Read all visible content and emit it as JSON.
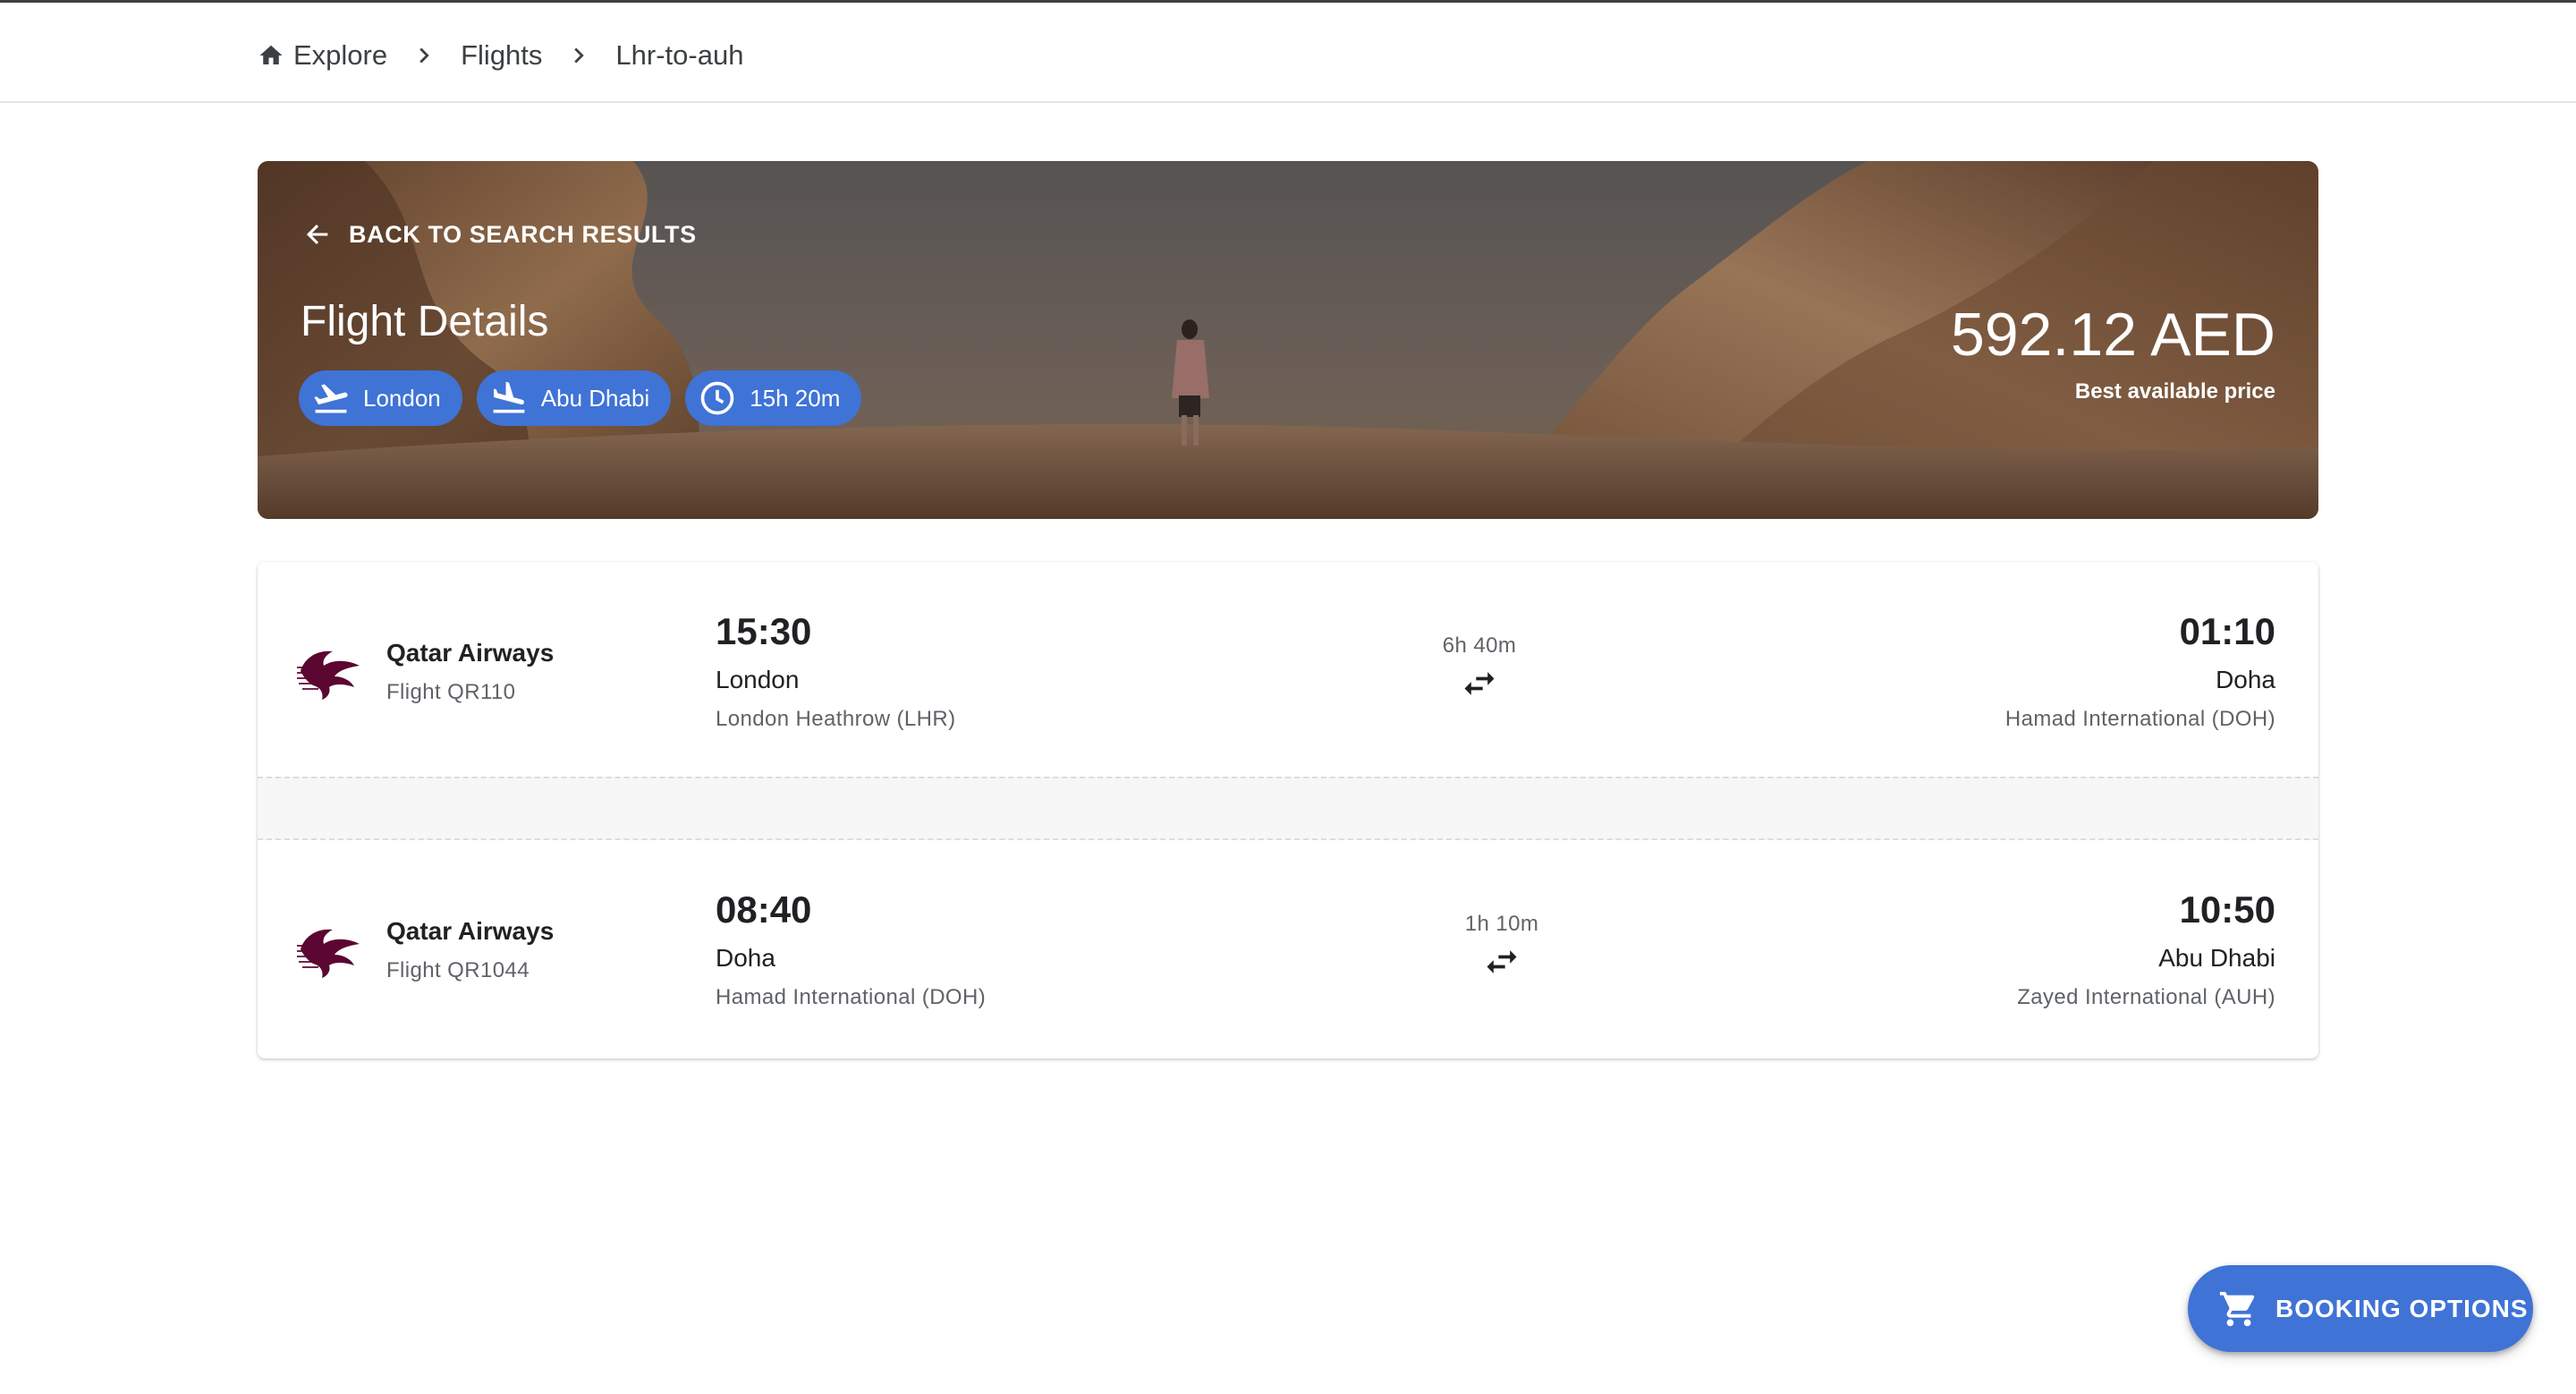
{
  "breadcrumb": {
    "items": [
      {
        "label": "Explore",
        "icon": "home-icon"
      },
      {
        "label": "Flights"
      },
      {
        "label": "Lhr-to-auh"
      }
    ]
  },
  "hero": {
    "back_label": "BACK TO SEARCH RESULTS",
    "title": "Flight Details",
    "chips": {
      "origin": "London",
      "destination": "Abu Dhabi",
      "duration": "15h 20m"
    },
    "price": "592.12 AED",
    "price_label": "Best available price"
  },
  "segments": [
    {
      "airline": "Qatar Airways",
      "flight": "Flight QR110",
      "departure": {
        "time": "15:30",
        "city": "London",
        "airport": "London Heathrow (LHR)"
      },
      "duration": "6h 40m",
      "arrival": {
        "time": "01:10",
        "city": "Doha",
        "airport": "Hamad International (DOH)"
      }
    },
    {
      "airline": "Qatar Airways",
      "flight": "Flight QR1044",
      "departure": {
        "time": "08:40",
        "city": "Doha",
        "airport": "Hamad International (DOH)"
      },
      "duration": "1h 10m",
      "arrival": {
        "time": "10:50",
        "city": "Abu Dhabi",
        "airport": "Zayed International (AUH)"
      }
    }
  ],
  "fab": {
    "label": "BOOKING OPTIONS",
    "icon": "cart-icon"
  },
  "colors": {
    "accent": "#3f73d6",
    "airline_brand": "#5c0632",
    "text_primary": "#202124",
    "text_secondary": "#5f6368"
  }
}
